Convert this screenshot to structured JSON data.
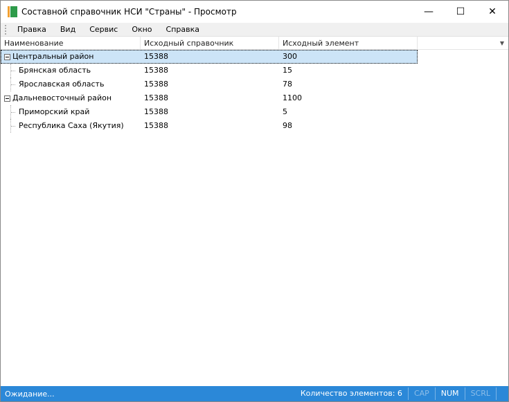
{
  "window": {
    "title": "Составной справочник НСИ \"Страны\" - Просмотр"
  },
  "menu": [
    "Правка",
    "Вид",
    "Сервис",
    "Окно",
    "Справка"
  ],
  "columns": [
    "Наименование",
    "Исходный справочник",
    "Исходный элемент"
  ],
  "rows": [
    {
      "name": "Центральный район",
      "dict": "15388",
      "elem": "300",
      "level": 0
    },
    {
      "name": "Брянская область",
      "dict": "15388",
      "elem": "15",
      "level": 1
    },
    {
      "name": "Ярославская область",
      "dict": "15388",
      "elem": "78",
      "level": 1
    },
    {
      "name": "Дальневосточный район",
      "dict": "15388",
      "elem": "1100",
      "level": 0
    },
    {
      "name": "Приморский край",
      "dict": "15388",
      "elem": "5",
      "level": 1
    },
    {
      "name": "Республика Саха (Якутия)",
      "dict": "15388",
      "elem": "98",
      "level": 1
    }
  ],
  "status": {
    "left": "Ожидание...",
    "count": "Количество элементов: 6",
    "cap": "CAP",
    "num": "NUM",
    "scrl": "SCRL"
  }
}
